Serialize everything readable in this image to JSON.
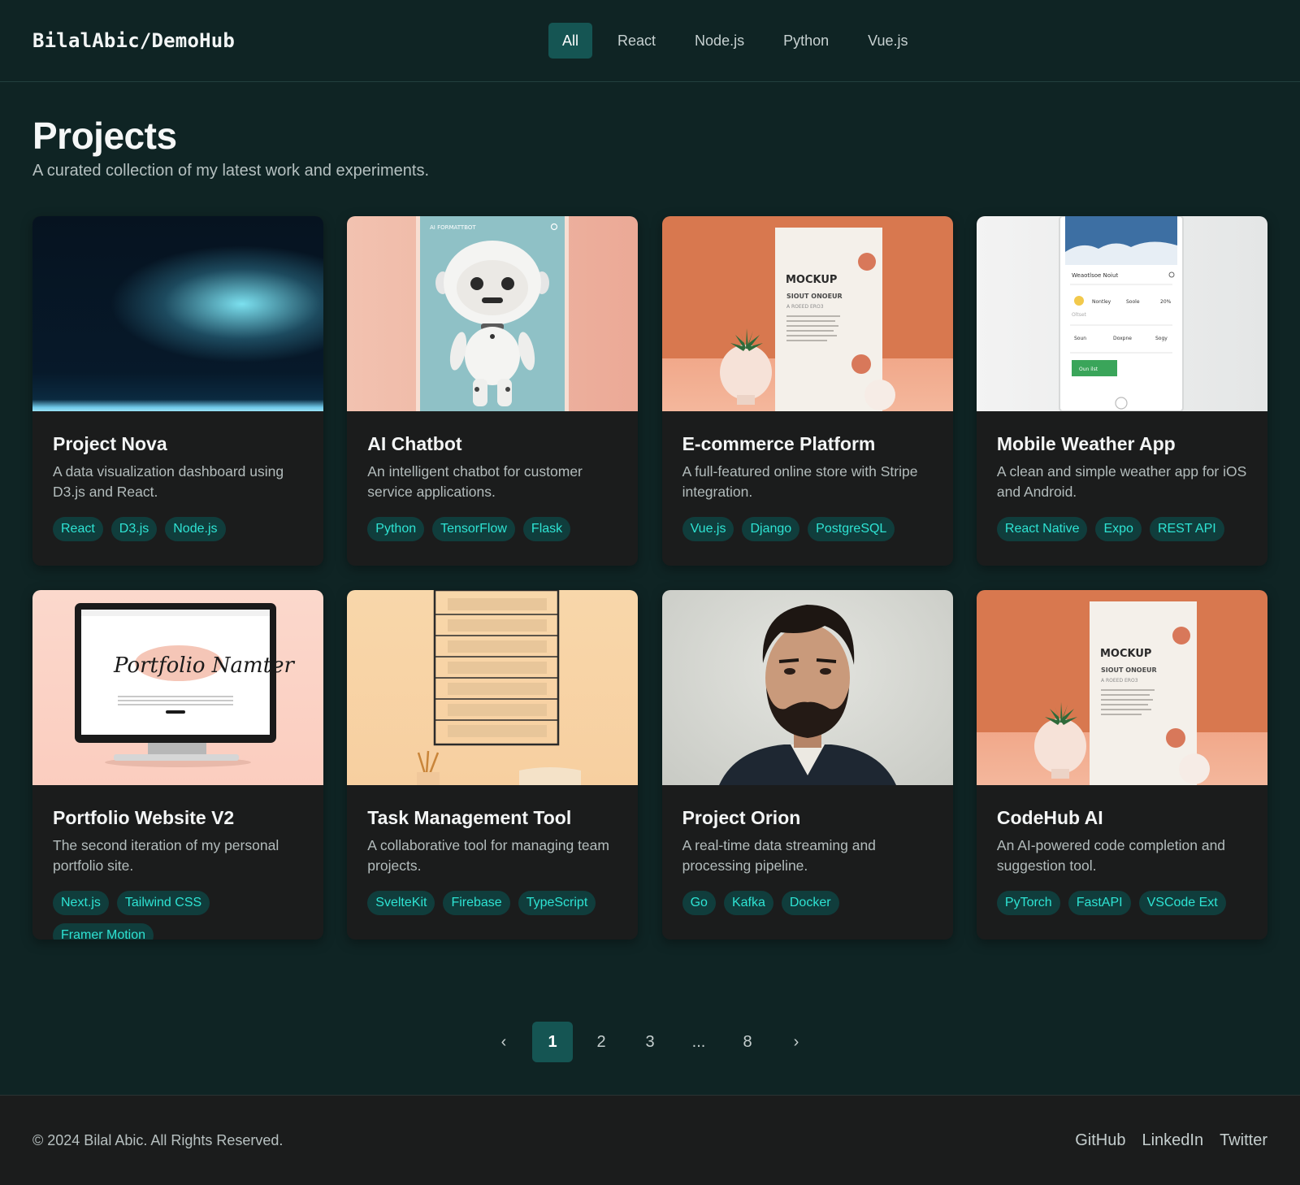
{
  "header": {
    "brand": "BilalAbic/DemoHub",
    "filters": [
      "All",
      "React",
      "Node.js",
      "Python",
      "Vue.js"
    ],
    "active_filter": "All"
  },
  "intro": {
    "title": "Projects",
    "subtitle": "A curated collection of my latest work and experiments."
  },
  "projects": [
    {
      "title": "Project Nova",
      "description": "A data visualization dashboard using D3.js and React.",
      "tags": [
        "React",
        "D3.js",
        "Node.js"
      ]
    },
    {
      "title": "AI Chatbot",
      "description": "An intelligent chatbot for customer service applications.",
      "tags": [
        "Python",
        "TensorFlow",
        "Flask"
      ]
    },
    {
      "title": "E-commerce Platform",
      "description": "A full-featured online store with Stripe integration.",
      "tags": [
        "Vue.js",
        "Django",
        "PostgreSQL"
      ]
    },
    {
      "title": "Mobile Weather App",
      "description": "A clean and simple weather app for iOS and Android.",
      "tags": [
        "React Native",
        "Expo",
        "REST API"
      ]
    },
    {
      "title": "Portfolio Website V2",
      "description": "The second iteration of my personal portfolio site.",
      "tags": [
        "Next.js",
        "Tailwind CSS",
        "Framer Motion"
      ]
    },
    {
      "title": "Task Management Tool",
      "description": "A collaborative tool for managing team projects.",
      "tags": [
        "SvelteKit",
        "Firebase",
        "TypeScript"
      ]
    },
    {
      "title": "Project Orion",
      "description": "A real-time data streaming and processing pipeline.",
      "tags": [
        "Go",
        "Kafka",
        "Docker"
      ]
    },
    {
      "title": "CodeHub AI",
      "description": "An AI-powered code completion and suggestion tool.",
      "tags": [
        "PyTorch",
        "FastAPI",
        "VSCode Ext"
      ]
    }
  ],
  "thumb_text": {
    "chat_header": "AI FORMATTBOT",
    "mockup_title": "MOCKUP",
    "mockup_sub": "SIOUT ONOEUR",
    "mockup_small": "A ROEED ERO3",
    "weather_header": "Weaotlsoe Noiut",
    "weather_row1": [
      "Nontley",
      "Soole",
      "20%"
    ],
    "weather_row1_sub": "Oltset",
    "weather_row2": [
      "Soun",
      "Doxpne",
      "Sogy"
    ],
    "weather_button": "Oun ilst",
    "portfolio_script": "Portfolio Namter"
  },
  "pagination": {
    "prev": "‹",
    "pages": [
      "1",
      "2",
      "3",
      "...",
      "8"
    ],
    "active": "1",
    "next": "›"
  },
  "footer": {
    "copyright": "© 2024 Bilal Abic. All Rights Reserved.",
    "links": [
      "GitHub",
      "LinkedIn",
      "Twitter"
    ]
  },
  "colors": {
    "background": "#0f2424",
    "card": "#1b1c1c",
    "accent": "#155553",
    "tag_text": "#2ee3d3",
    "tag_bg": "#103d3c"
  }
}
